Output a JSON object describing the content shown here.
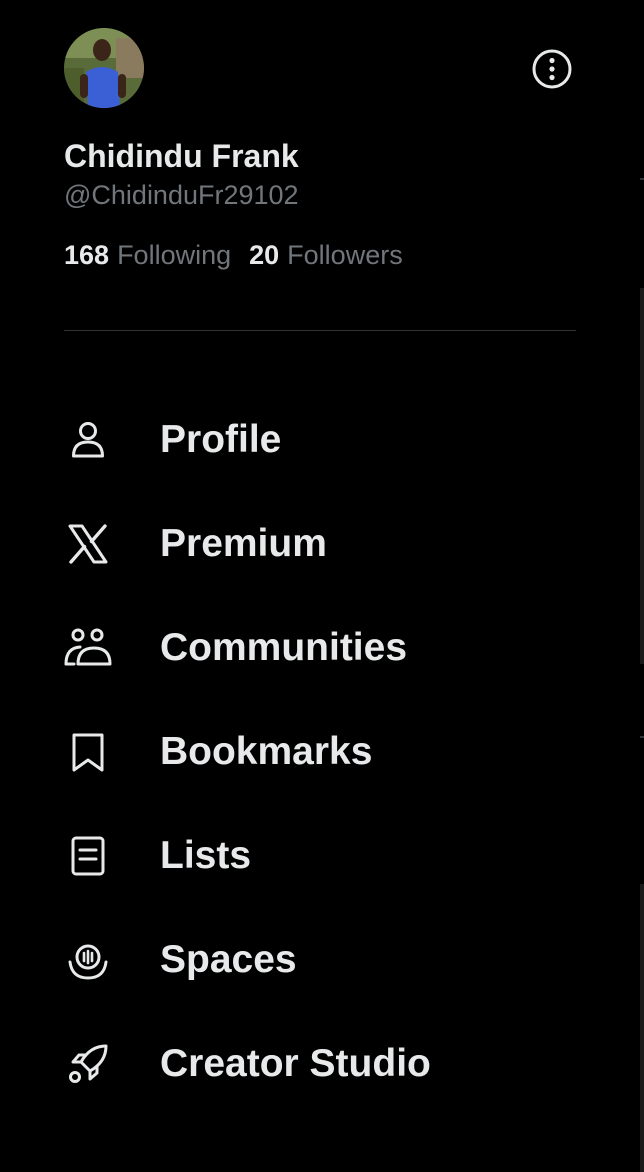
{
  "profile": {
    "display_name": "Chidindu Frank",
    "handle": "@ChidinduFr29102",
    "following_count": "168",
    "following_label": "Following",
    "followers_count": "20",
    "followers_label": "Followers"
  },
  "nav": {
    "items": [
      {
        "label": "Profile",
        "icon": "person-icon"
      },
      {
        "label": "Premium",
        "icon": "x-logo-icon"
      },
      {
        "label": "Communities",
        "icon": "communities-icon"
      },
      {
        "label": "Bookmarks",
        "icon": "bookmark-icon"
      },
      {
        "label": "Lists",
        "icon": "list-icon"
      },
      {
        "label": "Spaces",
        "icon": "spaces-icon"
      },
      {
        "label": "Creator Studio",
        "icon": "rocket-icon"
      }
    ]
  },
  "colors": {
    "background": "#000000",
    "primary_text": "#e7e9ea",
    "secondary_text": "#71767b",
    "divider": "#2f3336"
  }
}
